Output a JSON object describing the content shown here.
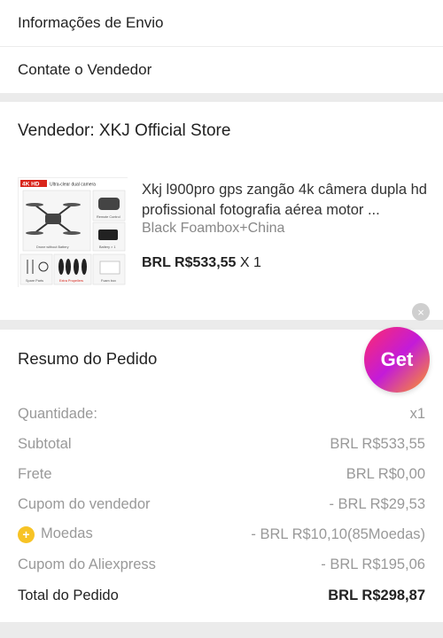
{
  "links": {
    "shipping_info": "Informações de Envio",
    "contact_seller": "Contate o Vendedor"
  },
  "seller": {
    "title": "Vendedor: XKJ Official Store"
  },
  "product": {
    "image_badge": "4K HD",
    "image_caption": "Ultra-clear dual camera",
    "image_labels": [
      "Remote Control",
      "Drone without Battery",
      "Battery × 1",
      "Spare Parts",
      "Extra Propellers",
      "Foam box"
    ],
    "name": "Xkj l900pro gps zangão 4k câmera dupla hd profissional fotografia aérea motor ...",
    "variant": "Black Foambox+China",
    "price": "BRL R$533,55",
    "qty_text": "X 1"
  },
  "promo": {
    "get_label": "Get",
    "close_glyph": "×"
  },
  "summary": {
    "title": "Resumo do Pedido",
    "rows": [
      {
        "label": "Quantidade:",
        "value": "x1"
      },
      {
        "label": "Subtotal",
        "value": "BRL R$533,55"
      },
      {
        "label": "Frete",
        "value": "BRL R$0,00"
      },
      {
        "label": "Cupom do vendedor",
        "value": "- BRL R$29,53"
      },
      {
        "label": "Moedas",
        "value": "- BRL R$10,10(85Moedas)"
      },
      {
        "label": "Cupom do Aliexpress",
        "value": "- BRL R$195,06"
      }
    ],
    "total_label": "Total do Pedido",
    "total_value": "BRL R$298,87"
  },
  "colors": {
    "background": "#ebebeb",
    "coin": "#f7c325",
    "badge": "#d9261c"
  },
  "icons": [
    "coin-icon",
    "close-icon"
  ]
}
